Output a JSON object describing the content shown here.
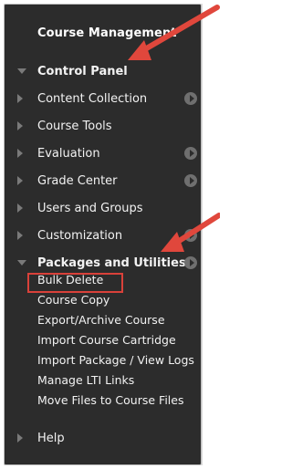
{
  "panel": {
    "title": "Course Management",
    "section": "Control Panel",
    "items": [
      {
        "label": "Content Collection",
        "has_go": true
      },
      {
        "label": "Course Tools",
        "has_go": false
      },
      {
        "label": "Evaluation",
        "has_go": true
      },
      {
        "label": "Grade Center",
        "has_go": true
      },
      {
        "label": "Users and Groups",
        "has_go": false
      },
      {
        "label": "Customization",
        "has_go": true
      }
    ],
    "packages": {
      "label": "Packages and Utilities",
      "subitems": [
        "Bulk Delete",
        "Course Copy",
        "Export/Archive Course",
        "Import Course Cartridge",
        "Import Package / View Logs",
        "Manage LTI Links",
        "Move Files to Course Files"
      ]
    },
    "help": "Help"
  },
  "colors": {
    "panel_bg": "#2c2c2c",
    "text": "#f2f2f2",
    "icon": "#7a7a7a",
    "annotation_red": "#e0473c"
  }
}
